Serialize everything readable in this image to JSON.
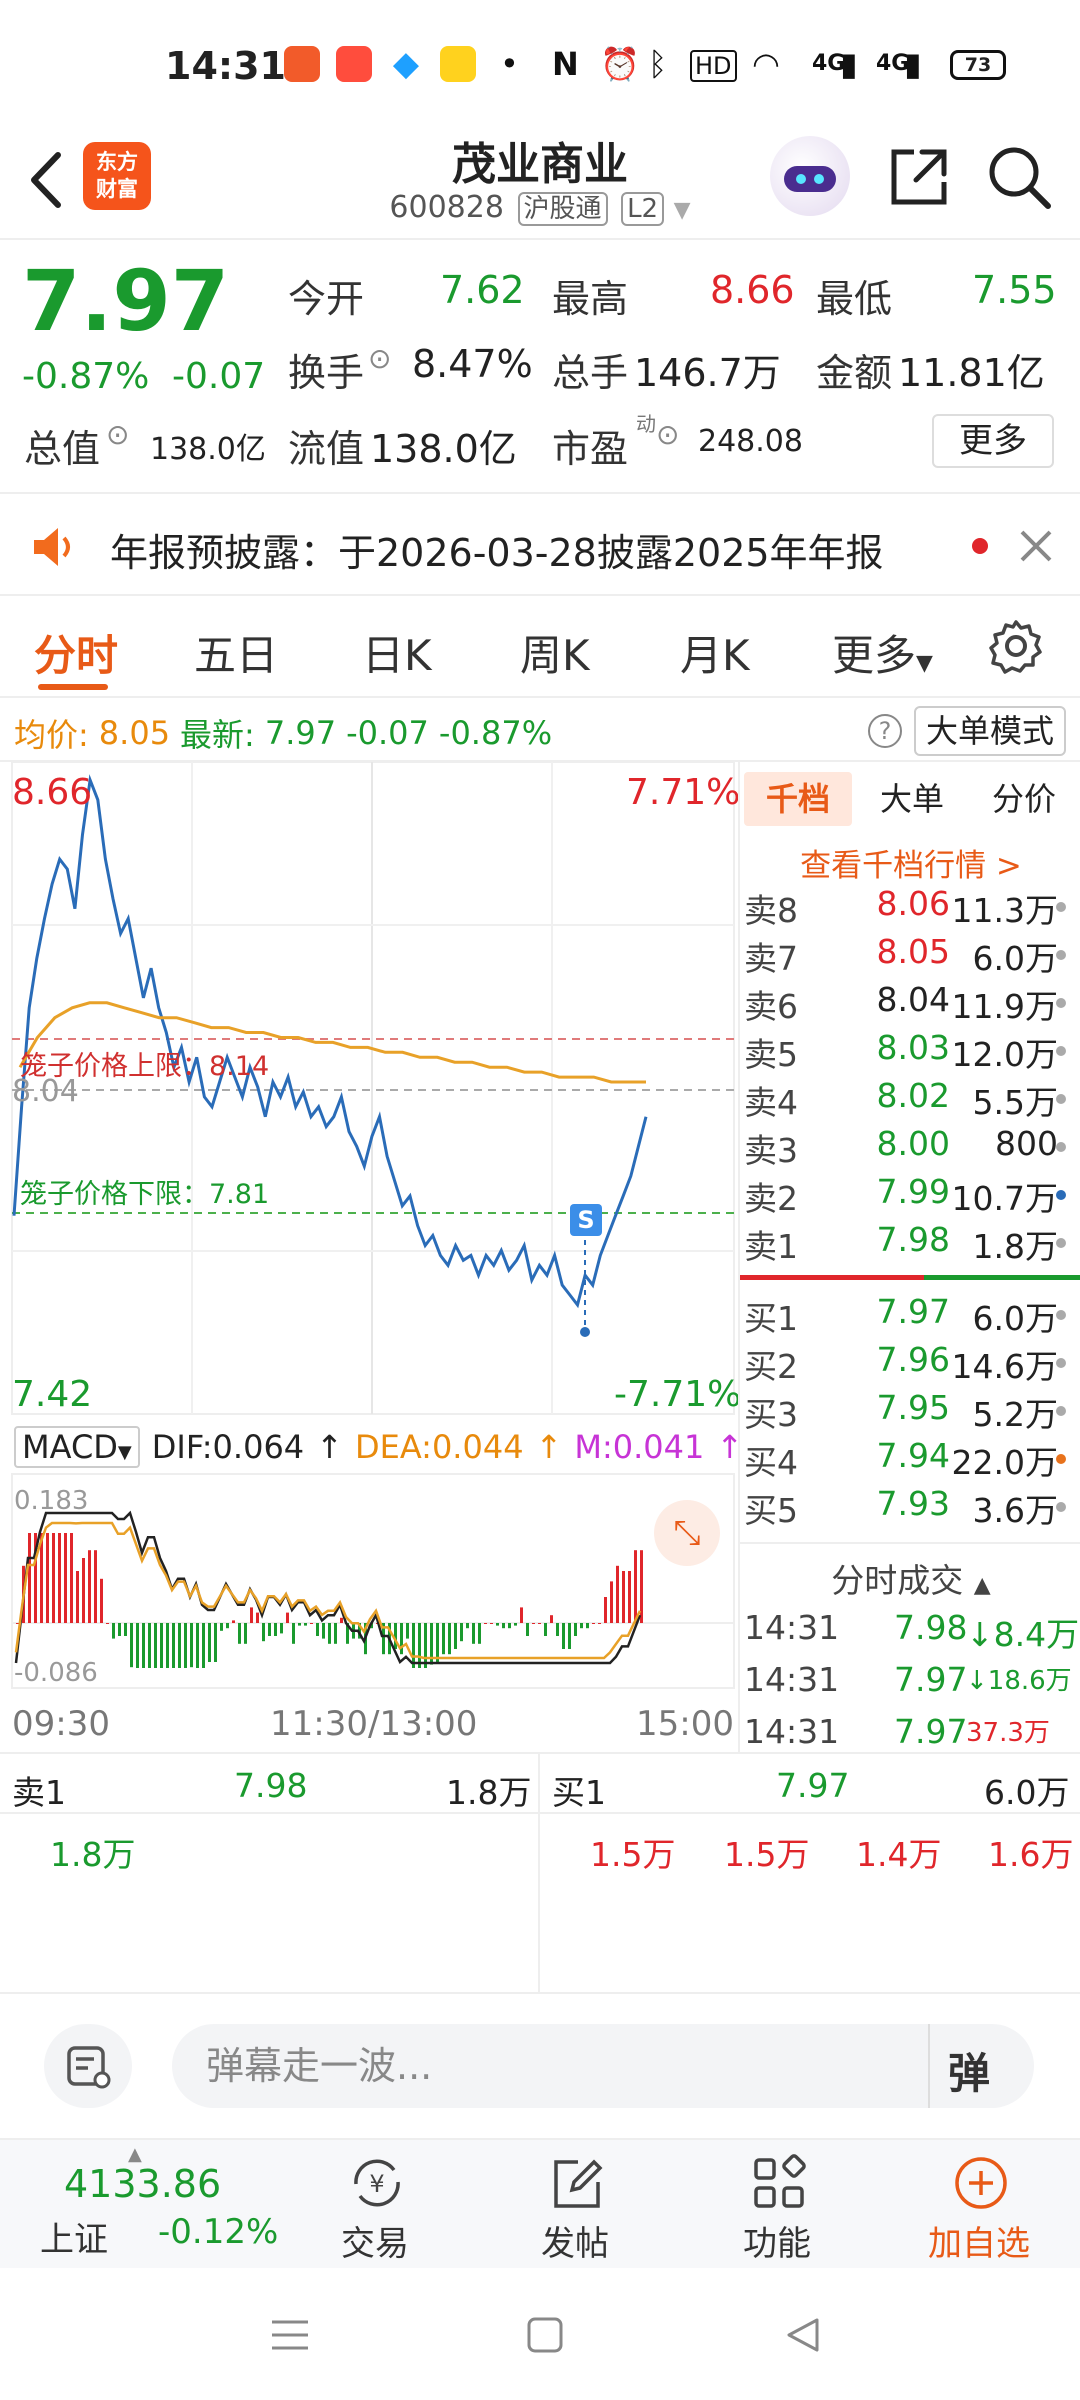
{
  "status": {
    "time": "14:31",
    "signal1": "4G",
    "signal2": "4G",
    "hd_label": "HD",
    "battery": "73"
  },
  "header": {
    "logo_line1": "东方",
    "logo_line2": "财富",
    "title": "茂业商业",
    "code": "600828",
    "tag1": "沪股通",
    "tag2": "L2"
  },
  "quote": {
    "price": "7.97",
    "change_pct": "-0.87%",
    "change": "-0.07",
    "open_label": "今开",
    "open": "7.62",
    "high_label": "最高",
    "high": "8.66",
    "low_label": "最低",
    "low": "7.55",
    "turnover_label": "换手",
    "turnover": "8.47%",
    "volume_label": "总手",
    "volume": "146.7万",
    "amount_label": "金额",
    "amount": "11.81亿",
    "mktcap_label": "总值",
    "mktcap": "138.0亿",
    "float_label": "流值",
    "float": "138.0亿",
    "pe_label": "市盈",
    "pe_sup": "动",
    "pe": "248.08",
    "more": "更多"
  },
  "notice": {
    "text": "年报预披露：于2026-03-28披露2025年年报"
  },
  "tabs": {
    "items": [
      "分时",
      "五日",
      "日K",
      "周K",
      "月K",
      "更多"
    ]
  },
  "infoline": {
    "avg_label": "均价:",
    "avg": "8.05",
    "latest_label": "最新:",
    "latest": "7.97",
    "change": "-0.07",
    "change_pct": "-0.87%",
    "mode_button": "大单模式"
  },
  "chart_data": {
    "type": "line",
    "top_price": "8.66",
    "bottom_price": "7.42",
    "top_pct": "7.71%",
    "bottom_pct": "-7.71%",
    "mid_price": "8.04",
    "upper_cage_label": "笼子价格上限：8.14",
    "lower_cage_label": "笼子价格下限：7.81",
    "x_labels": [
      "09:30",
      "11:30/13:00",
      "15:00"
    ],
    "y_range": [
      7.42,
      8.66
    ],
    "price_series": [
      7.78,
      8.0,
      8.2,
      8.3,
      8.38,
      8.45,
      8.5,
      8.48,
      8.4,
      8.55,
      8.66,
      8.62,
      8.5,
      8.42,
      8.35,
      8.38,
      8.3,
      8.22,
      8.28,
      8.2,
      8.15,
      8.08,
      8.12,
      8.05,
      8.1,
      8.02,
      8.0,
      8.05,
      8.1,
      8.06,
      8.02,
      8.08,
      8.04,
      7.98,
      8.05,
      8.02,
      8.06,
      8.0,
      8.03,
      7.98,
      8.0,
      7.96,
      7.98,
      8.02,
      7.95,
      7.92,
      7.88,
      7.94,
      7.98,
      7.9,
      7.85,
      7.8,
      7.82,
      7.76,
      7.72,
      7.74,
      7.7,
      7.68,
      7.72,
      7.69,
      7.7,
      7.66,
      7.7,
      7.68,
      7.71,
      7.67,
      7.69,
      7.72,
      7.65,
      7.68,
      7.66,
      7.7,
      7.64,
      7.62,
      7.6,
      7.66,
      7.64,
      7.7,
      7.74,
      7.78,
      7.82,
      7.86,
      7.92,
      7.98
    ],
    "avg_series": [
      8.08,
      8.14,
      8.18,
      8.2,
      8.21,
      8.21,
      8.2,
      8.19,
      8.18,
      8.18,
      8.17,
      8.16,
      8.16,
      8.15,
      8.15,
      8.14,
      8.14,
      8.13,
      8.13,
      8.12,
      8.12,
      8.11,
      8.11,
      8.1,
      8.1,
      8.09,
      8.09,
      8.08,
      8.08,
      8.07,
      8.07,
      8.06,
      8.06,
      8.06,
      8.05,
      8.05,
      8.05
    ],
    "macd_indicator": "MACD",
    "dif_label": "DIF:0.064",
    "dea_label": "DEA:0.044",
    "m_label": "M:0.041",
    "macd_top": "0.183",
    "macd_bottom": "-0.086"
  },
  "book": {
    "tabs": [
      "千档",
      "大单",
      "分价"
    ],
    "link": "查看千档行情 >",
    "asks": [
      {
        "label": "卖8",
        "price": "8.06",
        "vol": "11.3万",
        "cls": "red"
      },
      {
        "label": "卖7",
        "price": "8.05",
        "vol": "6.0万",
        "cls": "red"
      },
      {
        "label": "卖6",
        "price": "8.04",
        "vol": "11.9万",
        "cls": "black"
      },
      {
        "label": "卖5",
        "price": "8.03",
        "vol": "12.0万",
        "cls": "green"
      },
      {
        "label": "卖4",
        "price": "8.02",
        "vol": "5.5万",
        "cls": "green"
      },
      {
        "label": "卖3",
        "price": "8.00",
        "vol": "800",
        "cls": "green"
      },
      {
        "label": "卖2",
        "price": "7.99",
        "vol": "10.7万",
        "cls": "green"
      },
      {
        "label": "卖1",
        "price": "7.98",
        "vol": "1.8万",
        "cls": "green"
      }
    ],
    "bids": [
      {
        "label": "买1",
        "price": "7.97",
        "vol": "6.0万"
      },
      {
        "label": "买2",
        "price": "7.96",
        "vol": "14.6万"
      },
      {
        "label": "买3",
        "price": "7.95",
        "vol": "5.2万"
      },
      {
        "label": "买4",
        "price": "7.94",
        "vol": "22.0万"
      },
      {
        "label": "买5",
        "price": "7.93",
        "vol": "3.6万"
      }
    ],
    "trades_title": "分时成交",
    "trades": [
      {
        "time": "14:31",
        "price": "7.98",
        "vol": "↓8.4万"
      },
      {
        "time": "14:31",
        "price": "7.97",
        "vol": "↓18.6万"
      },
      {
        "time": "14:31",
        "price": "7.97",
        "vol": "37.3万"
      }
    ]
  },
  "level1": {
    "ask_label": "卖1",
    "ask_price": "7.98",
    "ask_vol": "1.8万",
    "bid_label": "买1",
    "bid_price": "7.97",
    "bid_vol": "6.0万",
    "ask_queue": [
      "1.8万"
    ],
    "bid_queue": [
      "1.5万",
      "1.5万",
      "1.4万",
      "1.6万"
    ]
  },
  "comment": {
    "placeholder": "弹幕走一波..."
  },
  "bottomnav": {
    "index_value": "4133.86",
    "index_name": "上证",
    "index_change": "-0.12%",
    "items": [
      "交易",
      "发帖",
      "功能",
      "加自选"
    ]
  }
}
